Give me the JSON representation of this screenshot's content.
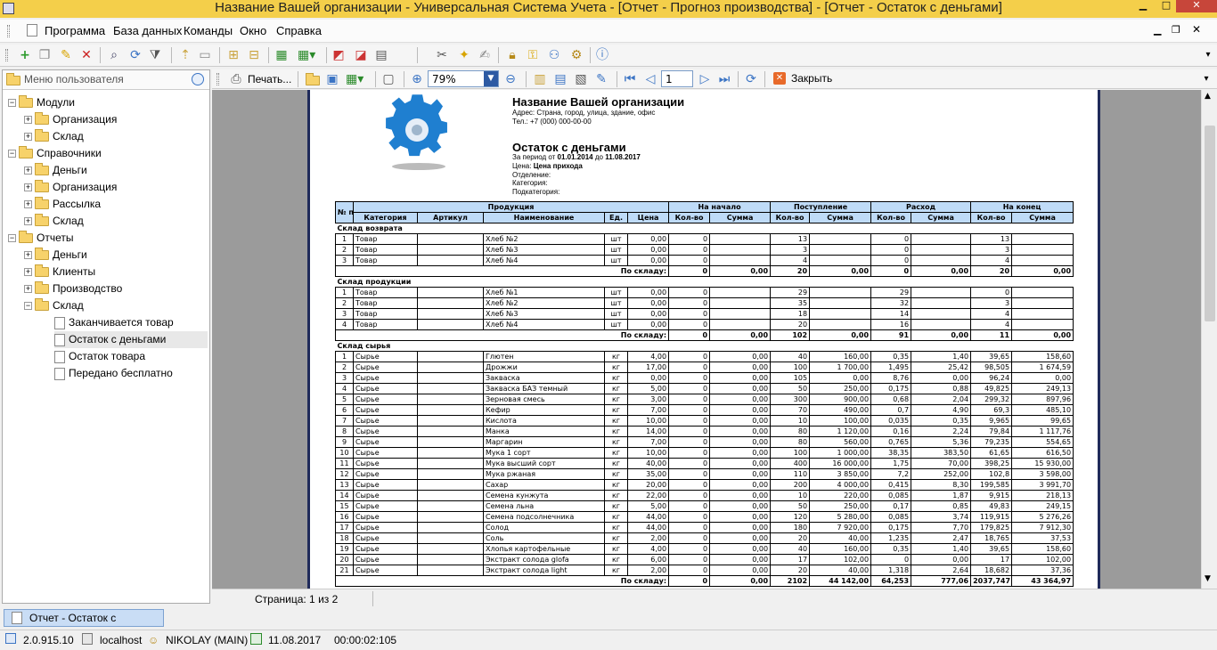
{
  "window": {
    "title": "Название Вашей организации - Универсальная Система Учета - [Отчет - Прогноз производства] - [Отчет - Остаток с деньгами]"
  },
  "menu": {
    "items": [
      "Программа",
      "База данных",
      "Команды",
      "Окно",
      "Справка"
    ]
  },
  "left_panel": {
    "search_placeholder": "Меню пользователя",
    "tree": [
      {
        "label": "Модули",
        "level": 0,
        "type": "folder",
        "expander": "−"
      },
      {
        "label": "Организация",
        "level": 1,
        "type": "folder",
        "expander": "+"
      },
      {
        "label": "Склад",
        "level": 1,
        "type": "folder",
        "expander": "+"
      },
      {
        "label": "Справочники",
        "level": 0,
        "type": "folder",
        "expander": "−"
      },
      {
        "label": "Деньги",
        "level": 1,
        "type": "folder",
        "expander": "+"
      },
      {
        "label": "Организация",
        "level": 1,
        "type": "folder",
        "expander": "+"
      },
      {
        "label": "Рассылка",
        "level": 1,
        "type": "folder",
        "expander": "+"
      },
      {
        "label": "Склад",
        "level": 1,
        "type": "folder",
        "expander": "+"
      },
      {
        "label": "Отчеты",
        "level": 0,
        "type": "folder",
        "expander": "−"
      },
      {
        "label": "Деньги",
        "level": 1,
        "type": "folder",
        "expander": "+"
      },
      {
        "label": "Клиенты",
        "level": 1,
        "type": "folder",
        "expander": "+"
      },
      {
        "label": "Производство",
        "level": 1,
        "type": "folder",
        "expander": "+"
      },
      {
        "label": "Склад",
        "level": 1,
        "type": "folder",
        "expander": "−"
      },
      {
        "label": "Заканчивается товар",
        "level": 2,
        "type": "doc",
        "expander": ""
      },
      {
        "label": "Остаток с деньгами",
        "level": 2,
        "type": "doc",
        "expander": ""
      },
      {
        "label": "Остаток товара",
        "level": 2,
        "type": "doc",
        "expander": ""
      },
      {
        "label": "Передано бесплатно",
        "level": 2,
        "type": "doc",
        "expander": ""
      }
    ]
  },
  "report_toolbar": {
    "print_label": "Печать...",
    "zoom": "79%",
    "page_input": "1",
    "close_label": "Закрыть"
  },
  "report": {
    "org_name": "Название Вашей организации",
    "address": "Адрес: Страна, город, улица, здание, офис",
    "phone": "Тел.: +7 (000) 000-00-00",
    "title": "Остаток с деньгами",
    "period_prefix": "За период от",
    "period_from": "01.01.2014",
    "period_mid": "до",
    "period_to": "11.08.2017",
    "price_prefix": "Цена:",
    "price_value": "Цена прихода",
    "department": "Отделение:",
    "category": "Категория:",
    "subcategory": "Подкатегория:",
    "headers": {
      "num": "№ п/п",
      "product": "Продукция",
      "start": "На начало",
      "income": "Поступление",
      "expense": "Расход",
      "end": "На конец",
      "category": "Категория",
      "article": "Артикул",
      "name": "Наименование",
      "unit": "Ед.",
      "price": "Цена",
      "qty": "Кол-во",
      "sum": "Сумма"
    },
    "total_label": "По складу:",
    "groups": [
      {
        "name": "Склад возврата",
        "rows": [
          [
            "1",
            "Товар",
            "",
            "Хлеб №2",
            "шт",
            "0,00",
            "0",
            "",
            "13",
            "",
            "0",
            "",
            "13",
            ""
          ],
          [
            "2",
            "Товар",
            "",
            "Хлеб №3",
            "шт",
            "0,00",
            "0",
            "",
            "3",
            "",
            "0",
            "",
            "3",
            ""
          ],
          [
            "3",
            "Товар",
            "",
            "Хлеб №4",
            "шт",
            "0,00",
            "0",
            "",
            "4",
            "",
            "0",
            "",
            "4",
            ""
          ]
        ],
        "total": [
          "0",
          "0,00",
          "20",
          "0,00",
          "0",
          "0,00",
          "20",
          "0,00"
        ]
      },
      {
        "name": "Склад продукции",
        "rows": [
          [
            "1",
            "Товар",
            "",
            "Хлеб №1",
            "шт",
            "0,00",
            "0",
            "",
            "29",
            "",
            "29",
            "",
            "0",
            ""
          ],
          [
            "2",
            "Товар",
            "",
            "Хлеб №2",
            "шт",
            "0,00",
            "0",
            "",
            "35",
            "",
            "32",
            "",
            "3",
            ""
          ],
          [
            "3",
            "Товар",
            "",
            "Хлеб №3",
            "шт",
            "0,00",
            "0",
            "",
            "18",
            "",
            "14",
            "",
            "4",
            ""
          ],
          [
            "4",
            "Товар",
            "",
            "Хлеб №4",
            "шт",
            "0,00",
            "0",
            "",
            "20",
            "",
            "16",
            "",
            "4",
            ""
          ]
        ],
        "total": [
          "0",
          "0,00",
          "102",
          "0,00",
          "91",
          "0,00",
          "11",
          "0,00"
        ]
      },
      {
        "name": "Склад сырья",
        "rows": [
          [
            "1",
            "Сырье",
            "",
            "Глютен",
            "кг",
            "4,00",
            "0",
            "0,00",
            "40",
            "160,00",
            "0,35",
            "1,40",
            "39,65",
            "158,60"
          ],
          [
            "2",
            "Сырье",
            "",
            "Дрожжи",
            "кг",
            "17,00",
            "0",
            "0,00",
            "100",
            "1 700,00",
            "1,495",
            "25,42",
            "98,505",
            "1 674,59"
          ],
          [
            "3",
            "Сырье",
            "",
            "Закваска",
            "кг",
            "0,00",
            "0",
            "0,00",
            "105",
            "0,00",
            "8,76",
            "0,00",
            "96,24",
            "0,00"
          ],
          [
            "4",
            "Сырье",
            "",
            "Закваска БАЗ темный",
            "кг",
            "5,00",
            "0",
            "0,00",
            "50",
            "250,00",
            "0,175",
            "0,88",
            "49,825",
            "249,13"
          ],
          [
            "5",
            "Сырье",
            "",
            "Зерновая смесь",
            "кг",
            "3,00",
            "0",
            "0,00",
            "300",
            "900,00",
            "0,68",
            "2,04",
            "299,32",
            "897,96"
          ],
          [
            "6",
            "Сырье",
            "",
            "Кефир",
            "кг",
            "7,00",
            "0",
            "0,00",
            "70",
            "490,00",
            "0,7",
            "4,90",
            "69,3",
            "485,10"
          ],
          [
            "7",
            "Сырье",
            "",
            "Кислота",
            "кг",
            "10,00",
            "0",
            "0,00",
            "10",
            "100,00",
            "0,035",
            "0,35",
            "9,965",
            "99,65"
          ],
          [
            "8",
            "Сырье",
            "",
            "Манка",
            "кг",
            "14,00",
            "0",
            "0,00",
            "80",
            "1 120,00",
            "0,16",
            "2,24",
            "79,84",
            "1 117,76"
          ],
          [
            "9",
            "Сырье",
            "",
            "Маргарин",
            "кг",
            "7,00",
            "0",
            "0,00",
            "80",
            "560,00",
            "0,765",
            "5,36",
            "79,235",
            "554,65"
          ],
          [
            "10",
            "Сырье",
            "",
            "Мука 1 сорт",
            "кг",
            "10,00",
            "0",
            "0,00",
            "100",
            "1 000,00",
            "38,35",
            "383,50",
            "61,65",
            "616,50"
          ],
          [
            "11",
            "Сырье",
            "",
            "Мука высший сорт",
            "кг",
            "40,00",
            "0",
            "0,00",
            "400",
            "16 000,00",
            "1,75",
            "70,00",
            "398,25",
            "15 930,00"
          ],
          [
            "12",
            "Сырье",
            "",
            "Мука ржаная",
            "кг",
            "35,00",
            "0",
            "0,00",
            "110",
            "3 850,00",
            "7,2",
            "252,00",
            "102,8",
            "3 598,00"
          ],
          [
            "13",
            "Сырье",
            "",
            "Сахар",
            "кг",
            "20,00",
            "0",
            "0,00",
            "200",
            "4 000,00",
            "0,415",
            "8,30",
            "199,585",
            "3 991,70"
          ],
          [
            "14",
            "Сырье",
            "",
            "Семена кунжута",
            "кг",
            "22,00",
            "0",
            "0,00",
            "10",
            "220,00",
            "0,085",
            "1,87",
            "9,915",
            "218,13"
          ],
          [
            "15",
            "Сырье",
            "",
            "Семена льна",
            "кг",
            "5,00",
            "0",
            "0,00",
            "50",
            "250,00",
            "0,17",
            "0,85",
            "49,83",
            "249,15"
          ],
          [
            "16",
            "Сырье",
            "",
            "Семена подсолнечника",
            "кг",
            "44,00",
            "0",
            "0,00",
            "120",
            "5 280,00",
            "0,085",
            "3,74",
            "119,915",
            "5 276,26"
          ],
          [
            "17",
            "Сырье",
            "",
            "Солод",
            "кг",
            "44,00",
            "0",
            "0,00",
            "180",
            "7 920,00",
            "0,175",
            "7,70",
            "179,825",
            "7 912,30"
          ],
          [
            "18",
            "Сырье",
            "",
            "Соль",
            "кг",
            "2,00",
            "0",
            "0,00",
            "20",
            "40,00",
            "1,235",
            "2,47",
            "18,765",
            "37,53"
          ],
          [
            "19",
            "Сырье",
            "",
            "Хлопья картофельные",
            "кг",
            "4,00",
            "0",
            "0,00",
            "40",
            "160,00",
            "0,35",
            "1,40",
            "39,65",
            "158,60"
          ],
          [
            "20",
            "Сырье",
            "",
            "Экстракт солода glofa",
            "кг",
            "6,00",
            "0",
            "0,00",
            "17",
            "102,00",
            "0",
            "0,00",
            "17",
            "102,00"
          ],
          [
            "21",
            "Сырье",
            "",
            "Экстракт солода light",
            "кг",
            "2,00",
            "0",
            "0,00",
            "20",
            "40,00",
            "1,318",
            "2,64",
            "18,682",
            "37,36"
          ]
        ],
        "total": [
          "0",
          "0,00",
          "2102",
          "44 142,00",
          "64,253",
          "777,06",
          "2037,747",
          "43 364,97"
        ]
      }
    ]
  },
  "page_status": "Страница: 1 из 2",
  "task_tab": "Отчет - Остаток с деньгами",
  "status": {
    "version": "2.0.915.10",
    "host": "localhost",
    "user": "NIKOLAY (MAIN)",
    "date": "11.08.2017",
    "timer": "00:00:02:105"
  }
}
